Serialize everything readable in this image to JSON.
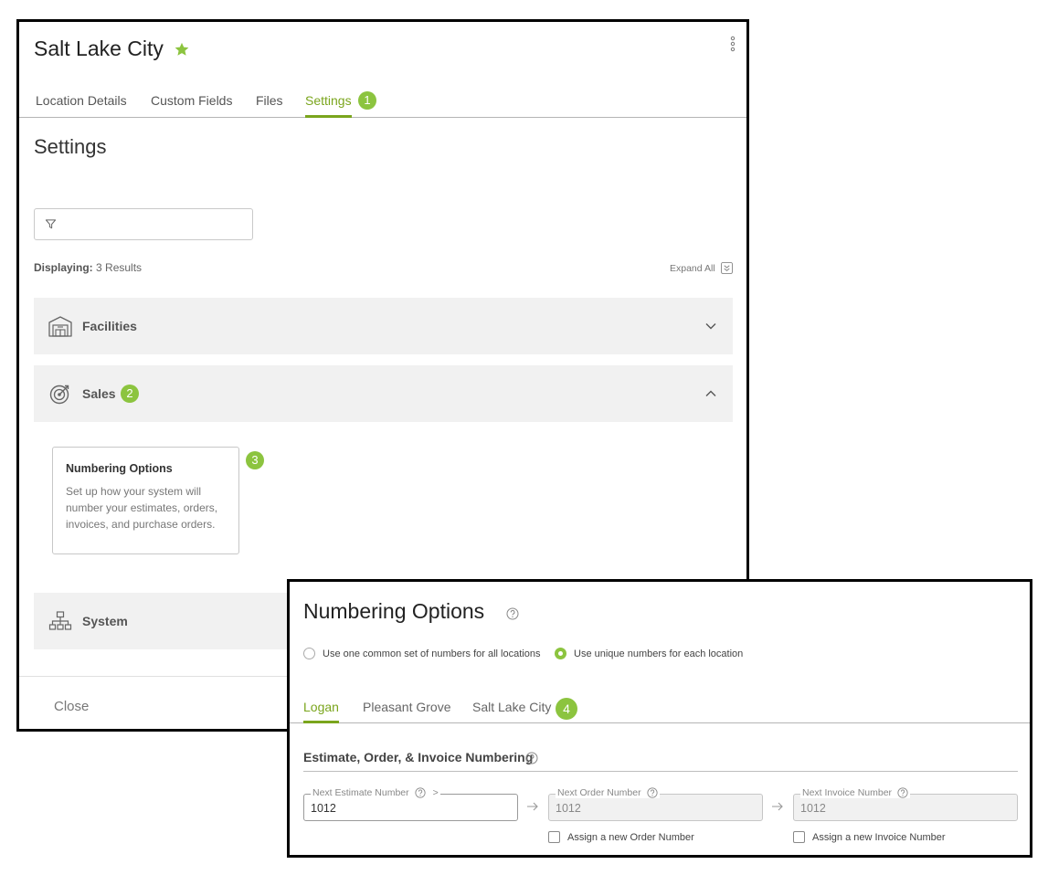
{
  "location": {
    "title": "Salt Lake City",
    "tabs": [
      {
        "label": "Location Details"
      },
      {
        "label": "Custom Fields"
      },
      {
        "label": "Files"
      },
      {
        "label": "Settings",
        "active": true
      }
    ],
    "tab_badge": "1"
  },
  "settings": {
    "heading": "Settings",
    "filter_value": "",
    "displaying_label": "Displaying:",
    "displaying_value": "3 Results",
    "expand_all": "Expand All",
    "sections": [
      {
        "label": "Facilities",
        "icon": "warehouse-icon",
        "expanded": false
      },
      {
        "label": "Sales",
        "icon": "target-icon",
        "expanded": true,
        "badge": "2"
      },
      {
        "label": "System",
        "icon": "sitemap-icon",
        "expanded": false
      }
    ],
    "card": {
      "title": "Numbering Options",
      "description": "Set up how your system will number your estimates, orders, invoices, and purchase orders.",
      "badge": "3"
    },
    "close_label": "Close"
  },
  "numbering": {
    "title": "Numbering Options",
    "options": [
      {
        "label": "Use one common set of numbers for all locations",
        "checked": false
      },
      {
        "label": "Use unique numbers for each location",
        "checked": true
      }
    ],
    "location_tabs": [
      {
        "label": "Logan",
        "active": true
      },
      {
        "label": "Pleasant Grove"
      },
      {
        "label": "Salt Lake City"
      }
    ],
    "location_badge": "4",
    "section_heading": "Estimate, Order, & Invoice Numbering",
    "fields": [
      {
        "label": "Next Estimate Number",
        "suffix": ">",
        "value": "1012",
        "disabled": false
      },
      {
        "label": "Next Order Number",
        "value": "1012",
        "disabled": true
      },
      {
        "label": "Next Invoice Number",
        "value": "1012",
        "disabled": true
      }
    ],
    "checkboxes": [
      {
        "label": "Assign a new Order Number",
        "checked": false
      },
      {
        "label": "Assign a new Invoice Number",
        "checked": false
      }
    ]
  },
  "colors": {
    "accent": "#7aa51c",
    "badge": "#8cc43f",
    "row_bg": "#f1f1f1"
  }
}
